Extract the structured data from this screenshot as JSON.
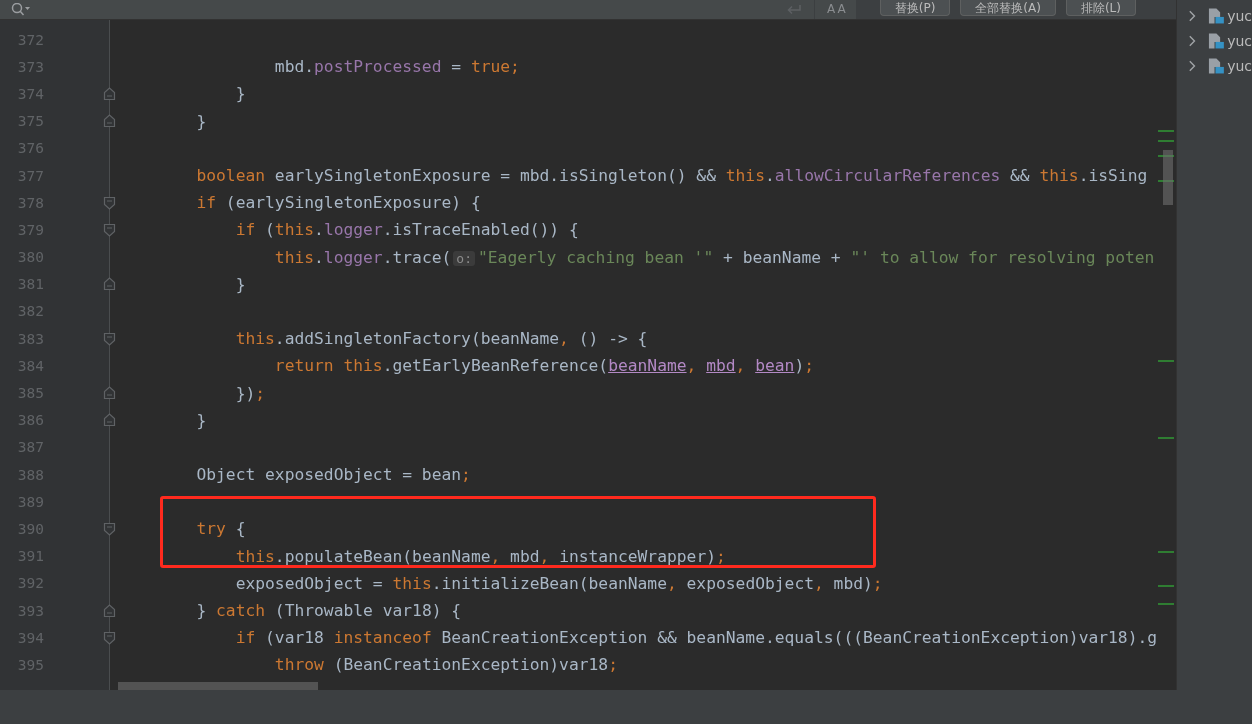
{
  "find_bar": {
    "match_case_toggle": "AA",
    "buttons": [
      {
        "label": "替换(P)"
      },
      {
        "label": "全部替换(A)"
      },
      {
        "label": "排除(L)"
      }
    ]
  },
  "editor": {
    "lines": [
      {
        "number": "372",
        "boxed": false
      },
      {
        "number": "373",
        "boxed": false,
        "tokens": [
          {
            "kind": "plain",
            "text": "                mbd."
          },
          {
            "kind": "field",
            "text": "postProcessed"
          },
          {
            "kind": "plain",
            "text": " = "
          },
          {
            "kind": "keyword",
            "text": "true;"
          }
        ]
      },
      {
        "number": "374",
        "fold": {
          "kind": "end"
        },
        "boxed": false,
        "tokens": [
          {
            "kind": "plain",
            "text": "            }"
          }
        ]
      },
      {
        "number": "375",
        "fold": {
          "kind": "end"
        },
        "boxed": false,
        "tokens": [
          {
            "kind": "plain",
            "text": "        }"
          }
        ]
      },
      {
        "number": "376",
        "boxed": false
      },
      {
        "number": "377",
        "boxed": false,
        "tokens": [
          {
            "kind": "keyword",
            "text": "        boolean"
          },
          {
            "kind": "plain",
            "text": " earlySingletonExposure = mbd.isSingleton() && "
          },
          {
            "kind": "keyword",
            "text": "this"
          },
          {
            "kind": "plain",
            "text": "."
          },
          {
            "kind": "field",
            "text": "allowCircularReferences"
          },
          {
            "kind": "plain",
            "text": " && "
          },
          {
            "kind": "keyword",
            "text": "this"
          },
          {
            "kind": "plain",
            "text": ".isSing"
          }
        ]
      },
      {
        "number": "378",
        "fold": {
          "kind": "start"
        },
        "boxed": false,
        "tokens": [
          {
            "kind": "keyword",
            "text": "        if"
          },
          {
            "kind": "plain",
            "text": " (earlySingletonExposure) {"
          }
        ]
      },
      {
        "number": "379",
        "fold": {
          "kind": "start"
        },
        "boxed": false,
        "tokens": [
          {
            "kind": "keyword",
            "text": "            if"
          },
          {
            "kind": "plain",
            "text": " ("
          },
          {
            "kind": "keyword",
            "text": "this"
          },
          {
            "kind": "plain",
            "text": "."
          },
          {
            "kind": "field",
            "text": "logger"
          },
          {
            "kind": "plain",
            "text": ".isTraceEnabled()) {"
          }
        ]
      },
      {
        "number": "380",
        "boxed": false,
        "tokens": [
          {
            "kind": "keyword",
            "text": "                this"
          },
          {
            "kind": "plain",
            "text": "."
          },
          {
            "kind": "field",
            "text": "logger"
          },
          {
            "kind": "plain",
            "text": ".trace("
          },
          {
            "kind": "hint",
            "text": "o:"
          },
          {
            "kind": "string",
            "text": "\"Eagerly caching bean '\""
          },
          {
            "kind": "plain",
            "text": " + beanName + "
          },
          {
            "kind": "string",
            "text": "\"' to allow for resolving poten"
          }
        ]
      },
      {
        "number": "381",
        "fold": {
          "kind": "end"
        },
        "boxed": false,
        "tokens": [
          {
            "kind": "plain",
            "text": "            }"
          }
        ]
      },
      {
        "number": "382",
        "boxed": false
      },
      {
        "number": "383",
        "fold": {
          "kind": "start"
        },
        "boxed": false,
        "tokens": [
          {
            "kind": "keyword",
            "text": "            this"
          },
          {
            "kind": "plain",
            "text": ".addSingletonFactory(beanName"
          },
          {
            "kind": "keyword",
            "text": ","
          },
          {
            "kind": "plain",
            "text": " () -> {"
          }
        ]
      },
      {
        "number": "384",
        "boxed": false,
        "tokens": [
          {
            "kind": "keyword",
            "text": "                return this"
          },
          {
            "kind": "plain",
            "text": ".getEarlyBeanReference("
          },
          {
            "kind": "captured",
            "text": "beanName"
          },
          {
            "kind": "keyword",
            "text": ", "
          },
          {
            "kind": "captured",
            "text": "mbd"
          },
          {
            "kind": "keyword",
            "text": ", "
          },
          {
            "kind": "captured",
            "text": "bean"
          },
          {
            "kind": "plain",
            "text": ")"
          },
          {
            "kind": "keyword",
            "text": ";"
          }
        ]
      },
      {
        "number": "385",
        "fold": {
          "kind": "end"
        },
        "boxed": false,
        "tokens": [
          {
            "kind": "plain",
            "text": "            })"
          },
          {
            "kind": "keyword",
            "text": ";"
          }
        ]
      },
      {
        "number": "386",
        "fold": {
          "kind": "end"
        },
        "boxed": false,
        "tokens": [
          {
            "kind": "plain",
            "text": "        }"
          }
        ]
      },
      {
        "number": "387",
        "boxed": false
      },
      {
        "number": "388",
        "boxed": false,
        "tokens": [
          {
            "kind": "plain",
            "text": "        Object exposedObject = bean"
          },
          {
            "kind": "keyword",
            "text": ";"
          }
        ]
      },
      {
        "number": "389",
        "boxed": true
      },
      {
        "number": "390",
        "fold": {
          "kind": "start"
        },
        "boxed": true,
        "tokens": [
          {
            "kind": "keyword",
            "text": "        try"
          },
          {
            "kind": "plain",
            "text": " {"
          }
        ]
      },
      {
        "number": "391",
        "boxed": true,
        "tokens": [
          {
            "kind": "keyword",
            "text": "            this"
          },
          {
            "kind": "plain",
            "text": ".populateBean(beanName"
          },
          {
            "kind": "keyword",
            "text": ","
          },
          {
            "kind": "plain",
            "text": " mbd"
          },
          {
            "kind": "keyword",
            "text": ","
          },
          {
            "kind": "plain",
            "text": " instanceWrapper)"
          },
          {
            "kind": "keyword",
            "text": ";"
          }
        ]
      },
      {
        "number": "392",
        "boxed": false,
        "tokens": [
          {
            "kind": "plain",
            "text": "            exposedObject = "
          },
          {
            "kind": "keyword",
            "text": "this"
          },
          {
            "kind": "plain",
            "text": ".initializeBean(beanName"
          },
          {
            "kind": "keyword",
            "text": ","
          },
          {
            "kind": "plain",
            "text": " exposedObject"
          },
          {
            "kind": "keyword",
            "text": ","
          },
          {
            "kind": "plain",
            "text": " mbd)"
          },
          {
            "kind": "keyword",
            "text": ";"
          }
        ]
      },
      {
        "number": "393",
        "fold": {
          "kind": "end"
        },
        "boxed": false,
        "tokens": [
          {
            "kind": "plain",
            "text": "        } "
          },
          {
            "kind": "keyword",
            "text": "catch"
          },
          {
            "kind": "plain",
            "text": " (Throwable var18) {"
          }
        ]
      },
      {
        "number": "394",
        "fold": {
          "kind": "start"
        },
        "boxed": false,
        "tokens": [
          {
            "kind": "keyword",
            "text": "            if"
          },
          {
            "kind": "plain",
            "text": " (var18 "
          },
          {
            "kind": "keyword",
            "text": "instanceof"
          },
          {
            "kind": "plain",
            "text": " BeanCreationException && beanName.equals(((BeanCreationException)var18).g"
          }
        ]
      },
      {
        "number": "395",
        "boxed": false,
        "tokens": [
          {
            "kind": "keyword",
            "text": "                throw"
          },
          {
            "kind": "plain",
            "text": " (BeanCreationException)var18"
          },
          {
            "kind": "keyword",
            "text": ";"
          }
        ]
      }
    ]
  },
  "project_tree": {
    "items": [
      {
        "label": "yuc",
        "expanded": false
      },
      {
        "label": "yuc",
        "expanded": false
      },
      {
        "label": "yuc",
        "expanded": false
      }
    ]
  }
}
